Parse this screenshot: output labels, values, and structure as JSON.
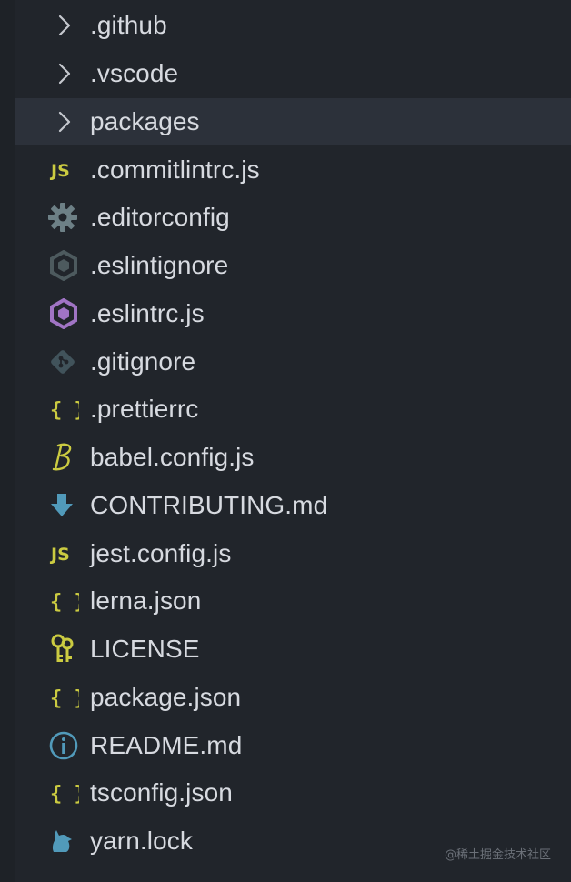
{
  "explorer": {
    "items": [
      {
        "label": ".github",
        "kind": "folder",
        "icon": "chevron-right-icon"
      },
      {
        "label": ".vscode",
        "kind": "folder",
        "icon": "chevron-right-icon"
      },
      {
        "label": "packages",
        "kind": "folder",
        "icon": "chevron-right-icon",
        "selected": true
      },
      {
        "label": ".commitlintrc.js",
        "kind": "file",
        "icon": "js-icon"
      },
      {
        "label": ".editorconfig",
        "kind": "file",
        "icon": "gear-icon"
      },
      {
        "label": ".eslintignore",
        "kind": "file",
        "icon": "eslint-muted-icon"
      },
      {
        "label": ".eslintrc.js",
        "kind": "file",
        "icon": "eslint-icon"
      },
      {
        "label": ".gitignore",
        "kind": "file",
        "icon": "git-icon"
      },
      {
        "label": ".prettierrc",
        "kind": "file",
        "icon": "json-braces-icon"
      },
      {
        "label": "babel.config.js",
        "kind": "file",
        "icon": "babel-icon"
      },
      {
        "label": "CONTRIBUTING.md",
        "kind": "file",
        "icon": "markdown-download-icon"
      },
      {
        "label": "jest.config.js",
        "kind": "file",
        "icon": "js-icon"
      },
      {
        "label": "lerna.json",
        "kind": "file",
        "icon": "json-braces-icon"
      },
      {
        "label": "LICENSE",
        "kind": "file",
        "icon": "keys-icon"
      },
      {
        "label": "package.json",
        "kind": "file",
        "icon": "json-braces-icon"
      },
      {
        "label": "README.md",
        "kind": "file",
        "icon": "info-icon"
      },
      {
        "label": "tsconfig.json",
        "kind": "file",
        "icon": "json-braces-icon"
      },
      {
        "label": "yarn.lock",
        "kind": "file",
        "icon": "yarn-cat-icon"
      }
    ]
  },
  "icons": {
    "js_text": "JS",
    "braces_text": "{ }"
  },
  "watermark": "@稀土掘金技术社区",
  "colors": {
    "background": "#21252b",
    "selected_row": "#2c313a",
    "label_text": "#d7dae0",
    "chevron": "#c5c8ce",
    "js_yellow": "#cbcb41",
    "gear_gray": "#6d8086",
    "eslint_muted": "#4d5a5e",
    "eslint_purple": "#a074c4",
    "git_gray": "#41535b",
    "babel_yellow": "#cbcb41",
    "markdown_blue": "#519aba",
    "license_yellow": "#cbcb41",
    "info_blue": "#519aba",
    "yarn_blue": "#519aba"
  }
}
